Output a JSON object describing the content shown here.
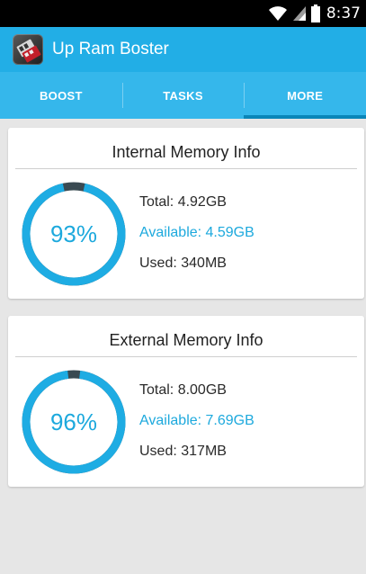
{
  "status_bar": {
    "time": "8:37",
    "icons": [
      "wifi-icon",
      "signal-icon",
      "battery-icon"
    ]
  },
  "app_bar": {
    "title": "Up Ram Boster",
    "icon": "ram-chip-icon"
  },
  "tabs": [
    {
      "label": "BOOST",
      "active": false
    },
    {
      "label": "TASKS",
      "active": false
    },
    {
      "label": "MORE",
      "active": true
    }
  ],
  "internal_memory": {
    "title": "Internal Memory Info",
    "percent_label": "93%",
    "percent": 93,
    "total": "Total: 4.92GB",
    "available": "Available: 4.59GB",
    "used": "Used: 340MB"
  },
  "external_memory": {
    "title": "External Memory Info",
    "percent_label": "96%",
    "percent": 96,
    "total": "Total: 8.00GB",
    "available": "Available: 7.69GB",
    "used": "Used: 317MB"
  },
  "colors": {
    "accent": "#22aee6",
    "tab_bg": "#35b7eb",
    "tab_indicator": "#0a86b8",
    "ring_track": "#3a4a52",
    "text_blue": "#1da9dd"
  }
}
